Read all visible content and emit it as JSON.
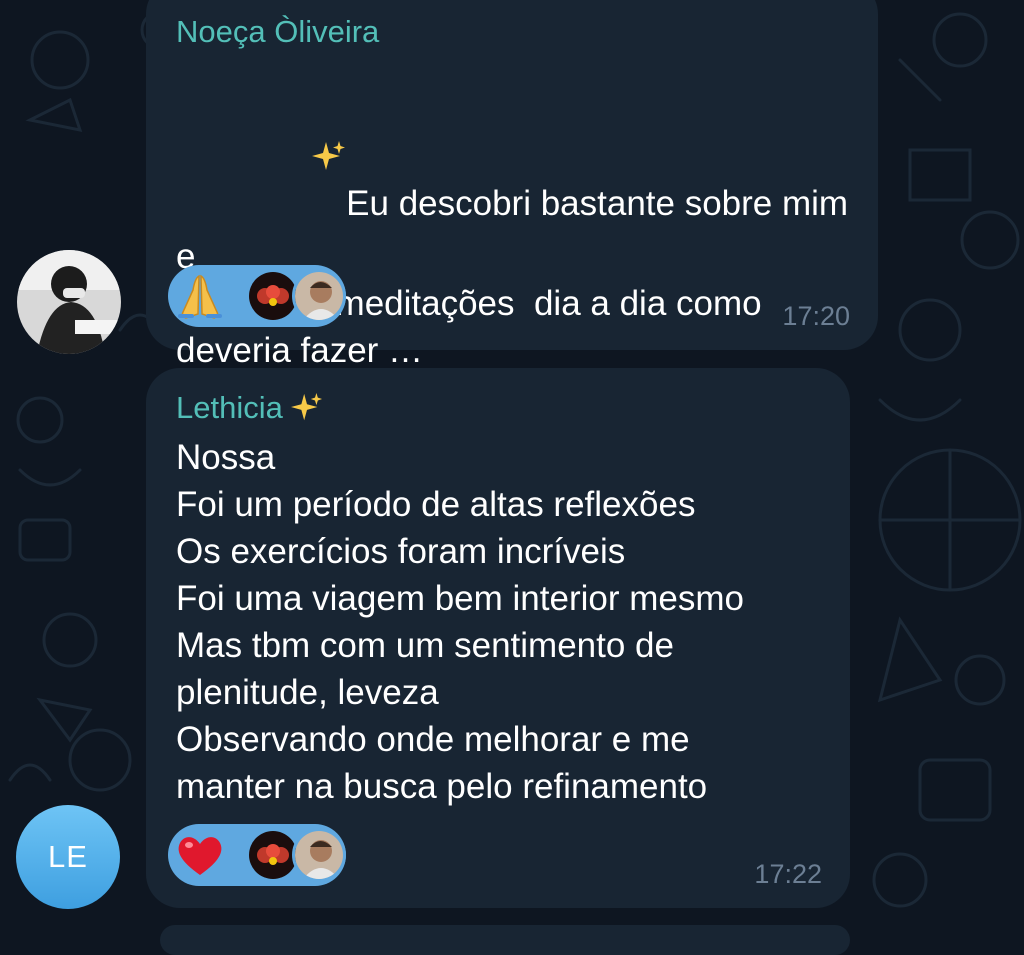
{
  "messages": [
    {
      "sender": "Noeça Òliveira",
      "text_line1_sparkle": "✨",
      "text": "Eu descobri bastante sobre mim e\nnão fiz as meditações  dia a dia como\ndeveria fazer …\n Gratidão  !",
      "trailing_emojis": [
        "✨",
        "🕎"
      ],
      "reaction_emoji": "🙏",
      "reactor_avatars": [
        "avatar-red-emblem",
        "avatar-man-photo"
      ],
      "time": "17:20",
      "avatar": "photo"
    },
    {
      "sender": "Lethicia",
      "sender_emoji": "✨",
      "text": "Nossa\nFoi um período de altas reflexões\nOs exercícios foram incríveis\nFoi uma viagem bem interior mesmo\nMas tbm com um sentimento de\nplenitude, leveza\nObservando onde melhorar e me\nmanter na busca pelo refinamento",
      "reaction_emoji": "❤️",
      "reactor_avatars": [
        "avatar-red-emblem",
        "avatar-man-photo"
      ],
      "time": "17:22",
      "avatar_initials": "LE"
    }
  ],
  "colors": {
    "background": "#0e1621",
    "bubble": "#182533",
    "sender_name": "#53bfb8",
    "reaction_pill": "#5fa8e0",
    "time": "#6c7f94"
  }
}
